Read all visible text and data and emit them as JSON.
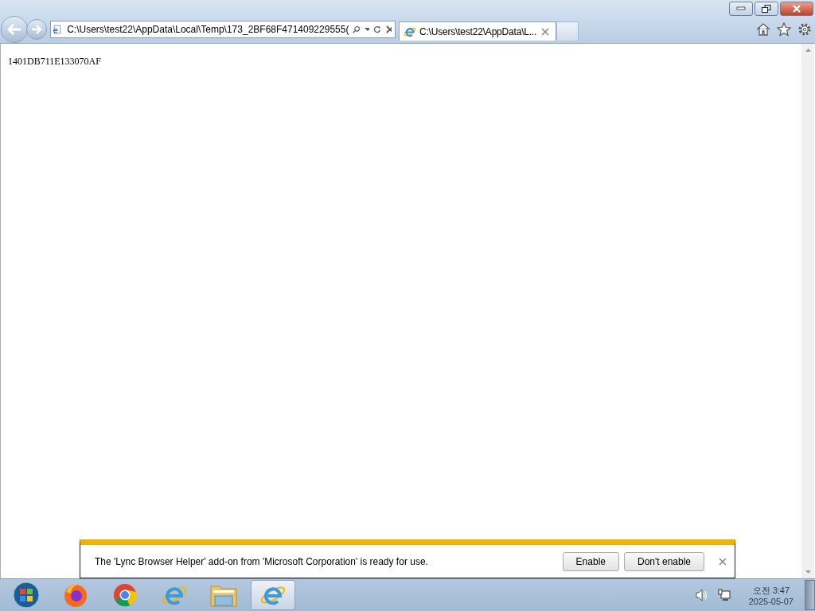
{
  "address_bar": {
    "value": "C:\\Users\\test22\\AppData\\Local\\Temp\\173_2BF68F471409229555("
  },
  "tabs": [
    {
      "label": "C:\\Users\\test22\\AppData\\L...",
      "selected": true
    }
  ],
  "page": {
    "text": "1401DB711E133070AF"
  },
  "notification": {
    "message": "The 'Lync Browser Helper' add-on from 'Microsoft Corporation' is ready for use.",
    "buttons": [
      "Enable",
      "Don't enable"
    ]
  },
  "taskbar": {
    "items": [
      {
        "kind": "start",
        "selected": false
      },
      {
        "kind": "firefox",
        "selected": false
      },
      {
        "kind": "chrome",
        "selected": false
      },
      {
        "kind": "ie",
        "selected": false
      },
      {
        "kind": "folder",
        "selected": false
      },
      {
        "kind": "ie",
        "selected": true
      }
    ],
    "clock": {
      "time": "오전 3:47",
      "date": "2025-05-07"
    }
  }
}
